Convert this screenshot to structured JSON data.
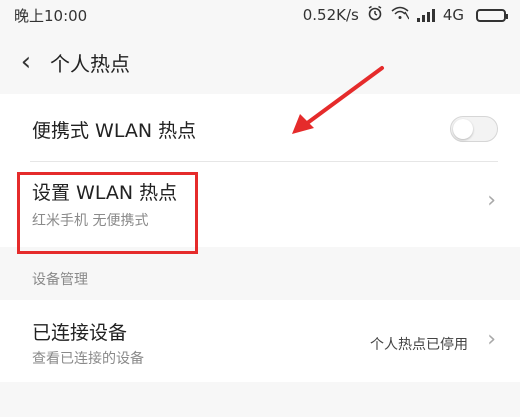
{
  "status_bar": {
    "time": "晚上10:00",
    "speed": "0.52K/s",
    "network": "4G",
    "icons": [
      "alarm-icon",
      "wifi-off-icon",
      "signal-icon",
      "battery-icon"
    ]
  },
  "header": {
    "back_glyph": "‹",
    "title": "个人热点"
  },
  "portable_hotspot": {
    "label": "便携式 WLAN 热点",
    "enabled": false
  },
  "setup_hotspot": {
    "label": "设置 WLAN 热点",
    "subtitle": "红米手机 无便携式",
    "chevron": "›"
  },
  "device_section": {
    "label": "设备管理"
  },
  "connected_devices": {
    "label": "已连接设备",
    "subtitle": "查看已连接的设备",
    "status": "个人热点已停用",
    "chevron": "›"
  },
  "colors": {
    "annotation_red": "#e52b2b",
    "background": "#f7f7f7"
  }
}
